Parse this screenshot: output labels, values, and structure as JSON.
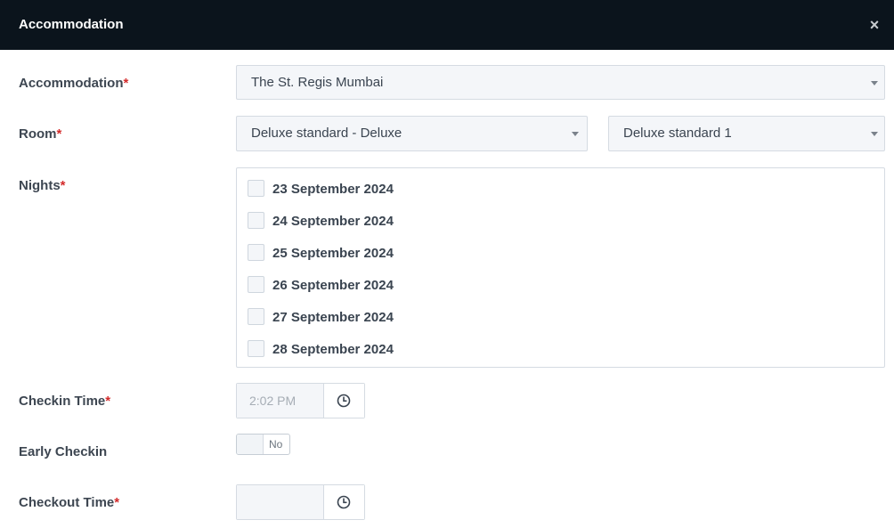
{
  "modal": {
    "title": "Accommodation",
    "close_glyph": "×"
  },
  "fields": {
    "accommodation": {
      "label": "Accommodation",
      "required_mark": "*",
      "value": "The St. Regis Mumbai"
    },
    "room": {
      "label": "Room",
      "required_mark": "*",
      "type_value": "Deluxe standard - Deluxe",
      "room_value": "Deluxe standard 1"
    },
    "nights": {
      "label": "Nights",
      "required_mark": "*",
      "options": [
        {
          "label": "23 September 2024",
          "checked": false
        },
        {
          "label": "24 September 2024",
          "checked": false
        },
        {
          "label": "25 September 2024",
          "checked": false
        },
        {
          "label": "26 September 2024",
          "checked": false
        },
        {
          "label": "27 September 2024",
          "checked": false
        },
        {
          "label": "28 September 2024",
          "checked": false
        }
      ]
    },
    "checkin_time": {
      "label": "Checkin Time",
      "required_mark": "*",
      "placeholder": "2:02 PM",
      "icon": "clock-icon"
    },
    "early_checkin": {
      "label": "Early Checkin",
      "toggle_text": "No",
      "enabled": false
    },
    "checkout_time": {
      "label": "Checkout Time",
      "required_mark": "*",
      "placeholder": "",
      "icon": "clock-icon"
    }
  },
  "colors": {
    "header_bg": "#0b141c",
    "required": "#d32b2b",
    "field_bg": "#f4f6f9"
  }
}
